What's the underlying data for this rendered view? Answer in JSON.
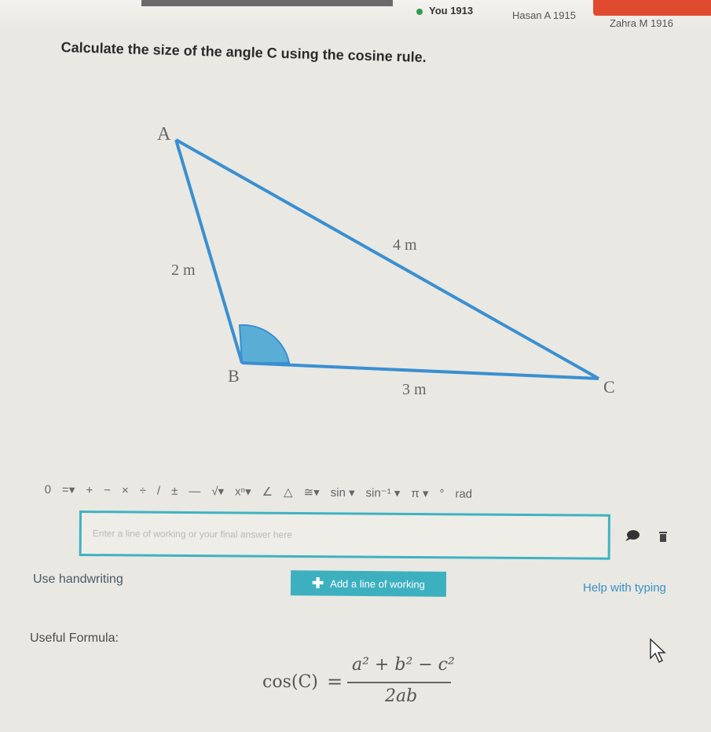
{
  "leaderboard": {
    "you": "You 1913",
    "hasan": "Hasan A 1915",
    "zahra": "Zahra M 1916"
  },
  "question": "Calculate the size of the angle C using the cosine rule.",
  "diagram": {
    "vertices": {
      "A": "A",
      "B": "B",
      "C": "C"
    },
    "sides": {
      "AB": "2 m",
      "AC": "4 m",
      "BC": "3 m"
    },
    "line_color": "#3a8fd1",
    "angle_fill": "#5aaed6"
  },
  "toolbar": {
    "items": [
      "0",
      "=▾",
      "+",
      "−",
      "×",
      "÷",
      "/",
      "±",
      "—",
      "√▾",
      "xⁿ▾",
      "∠",
      "△",
      "≅▾",
      "sin ▾",
      "sin⁻¹ ▾",
      "π ▾",
      "°",
      "rad"
    ]
  },
  "answer": {
    "placeholder": "Enter a line of working or your final answer here",
    "value": ""
  },
  "controls": {
    "use_handwriting": "Use handwriting",
    "add_line": "Add a line of working",
    "help_typing": "Help with typing"
  },
  "formula": {
    "label": "Useful Formula:",
    "lhs": "cos(C)",
    "equals": "=",
    "numerator": "a² + b² − c²",
    "denominator": "2ab"
  },
  "colors": {
    "accent": "#3db0c0",
    "link": "#3a90c6",
    "leaderboard_dot": "#2f9a54"
  }
}
